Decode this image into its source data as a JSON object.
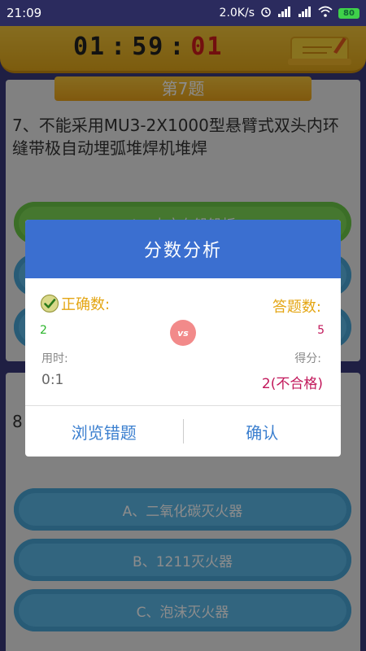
{
  "status_bar": {
    "time": "21:09",
    "speed": "2.0K/s",
    "battery": "80"
  },
  "timer": {
    "hours": "01",
    "minutes": "59",
    "seconds": "01",
    "separator": ":"
  },
  "question1": {
    "number_label": "第7题",
    "text": "7、不能采用MU3-2X1000型悬臂式双头内环缝带极自动埋弧堆焊机堆焊",
    "option_a": "A、内衣在铅铅板"
  },
  "question2": {
    "text_prefix": "8",
    "options": [
      "A、二氧化碳灭火器",
      "B、1211灭火器",
      "C、泡沫灭火器"
    ]
  },
  "dialog": {
    "title": "分数分析",
    "correct_label": "正确数:",
    "answered_label": "答题数:",
    "correct_count": "2",
    "answered_count": "5",
    "vs": "vs",
    "time_label": "用时:",
    "time_value": "0:1",
    "score_label": "得分:",
    "score_value": "2(不合格)",
    "review_button": "浏览错题",
    "confirm_button": "确认"
  },
  "colors": {
    "dialog_header": "#3b6fd0",
    "label_gold": "#e4a614",
    "correct_green": "#2bb52b",
    "score_red": "#c2185b",
    "button_blue": "#3b7fcf",
    "timer_header": "#f4c63a"
  }
}
